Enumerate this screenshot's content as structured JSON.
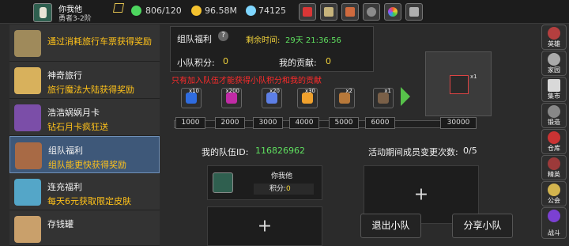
{
  "player": {
    "name": "你我他",
    "rank": "勇者3-2阶"
  },
  "stats": {
    "energy": "806/120",
    "gold": "96.58M",
    "gems": "74125"
  },
  "sidebar": [
    {
      "title": "",
      "subtitle": "通过消耗旅行车票获得奖励",
      "color": "#9f8a5b"
    },
    {
      "title": "神奇旅行",
      "subtitle": "旅行魔法大陆获得奖励",
      "color": "#d8b15c"
    },
    {
      "title": "浩浩娲娲月卡",
      "subtitle": "钻石月卡疯狂送",
      "color": "#7b4ea8"
    },
    {
      "title": "组队福利",
      "subtitle": "组队能更快获得奖励",
      "color": "#a86a45"
    },
    {
      "title": "连充福利",
      "subtitle": "每天6元获取限定皮肤",
      "color": "#54a6c8"
    },
    {
      "title": "存钱罐",
      "subtitle": "",
      "color": "#c9a06b"
    }
  ],
  "team": {
    "title": "组队福利",
    "remain_label": "剩余时间:",
    "remain": "29天 21:36:56",
    "team_points_label": "小队积分:",
    "team_points": "0",
    "contrib_label": "我的贡献:",
    "contrib": "0",
    "notice": "只有加入队伍才能获得小队积分和我的贡献"
  },
  "rewards": [
    {
      "count": "x10",
      "color": "#2f6ce0"
    },
    {
      "count": "x200",
      "color": "#c12ba6"
    },
    {
      "count": "x20",
      "color": "#5d7fe6"
    },
    {
      "count": "x30",
      "color": "#f0a12d"
    },
    {
      "count": "x2",
      "color": "#b8793a"
    },
    {
      "count": "x1",
      "color": "#7a6048"
    }
  ],
  "milestones": [
    "1000",
    "2000",
    "3000",
    "4000",
    "5000",
    "6000",
    "30000"
  ],
  "preview": {
    "count": "x1"
  },
  "team_id_label": "我的队伍ID:",
  "team_id": "116826962",
  "change_label": "活动期间成员变更次数:",
  "change_count": "0/5",
  "member": {
    "name": "你我他",
    "points_label": "积分:",
    "points": "0"
  },
  "buttons": {
    "leave": "退出小队",
    "share": "分享小队",
    "plus": "+"
  },
  "right_nav": [
    "英雄",
    "家园",
    "集市",
    "锻造",
    "仓库",
    "精英",
    "公会",
    "战斗"
  ]
}
